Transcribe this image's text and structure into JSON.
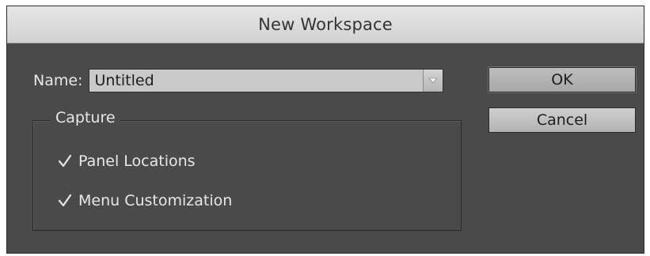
{
  "dialog": {
    "title": "New Workspace",
    "name_label": "Name:",
    "name_value": "Untitled",
    "capture": {
      "legend": "Capture",
      "options": [
        {
          "label": "Panel Locations",
          "checked": true
        },
        {
          "label": "Menu Customization",
          "checked": true
        }
      ]
    },
    "buttons": {
      "ok": "OK",
      "cancel": "Cancel"
    }
  },
  "icons": {
    "dropdown": "chevron-down-icon",
    "check": "checkmark-icon"
  },
  "colors": {
    "dialog_bg": "#4a4a4a",
    "title_bar": "#dcdcdc",
    "field_bg": "#c9c9c9",
    "text_light": "#e8e8e8"
  }
}
